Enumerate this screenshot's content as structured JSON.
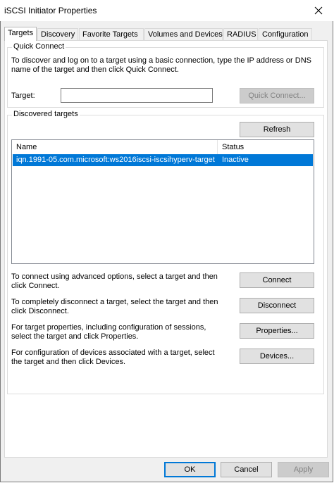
{
  "window": {
    "title": "iSCSI Initiator Properties"
  },
  "tabs": [
    {
      "label": "Targets"
    },
    {
      "label": "Discovery"
    },
    {
      "label": "Favorite Targets"
    },
    {
      "label": "Volumes and Devices"
    },
    {
      "label": "RADIUS"
    },
    {
      "label": "Configuration"
    }
  ],
  "quick_connect": {
    "legend": "Quick Connect",
    "description": "To discover and log on to a target using a basic connection, type the IP address or DNS name of the target and then click Quick Connect.",
    "target_label": "Target:",
    "target_value": "",
    "button": "Quick Connect..."
  },
  "discovered": {
    "legend": "Discovered targets",
    "refresh_button": "Refresh",
    "columns": [
      "Name",
      "Status"
    ],
    "rows": [
      {
        "name": "iqn.1991-05.com.microsoft:ws2016iscsi-iscsihyperv-target",
        "status": "Inactive",
        "selected": true
      }
    ]
  },
  "actions": [
    {
      "text": "To connect using advanced options, select a target and then click Connect.",
      "button": "Connect"
    },
    {
      "text": "To completely disconnect a target, select the target and then click Disconnect.",
      "button": "Disconnect"
    },
    {
      "text": "For target properties, including configuration of sessions, select the target and click Properties.",
      "button": "Properties..."
    },
    {
      "text": "For configuration of devices associated with a target, select the target and then click Devices.",
      "button": "Devices..."
    }
  ],
  "footer": {
    "ok": "OK",
    "cancel": "Cancel",
    "apply": "Apply"
  },
  "colors": {
    "selection": "#0078d7",
    "dialog_bg": "#f0f0f0",
    "button_bg": "#e1e1e1"
  }
}
